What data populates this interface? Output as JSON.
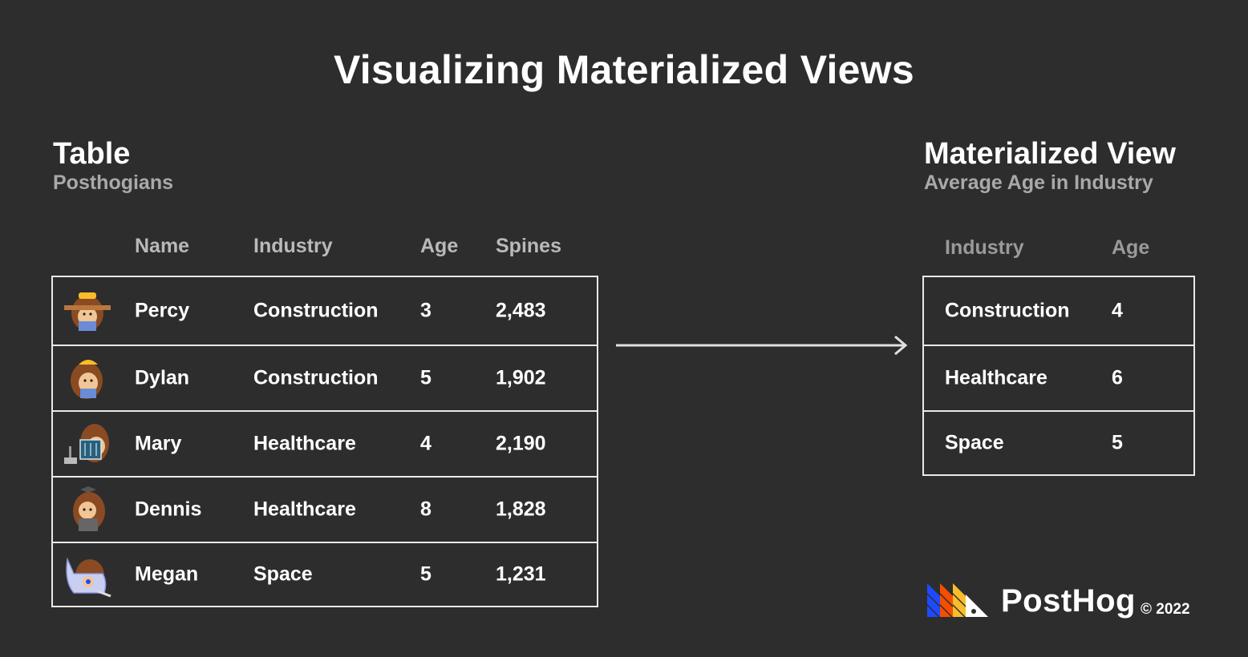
{
  "title": "Visualizing Materialized Views",
  "table": {
    "title": "Table",
    "subtitle": "Posthogians",
    "columns": [
      "Name",
      "Industry",
      "Age",
      "Spines"
    ],
    "rows": [
      {
        "name": "Percy",
        "industry": "Construction",
        "age": "3",
        "spines": "2,483",
        "avatar": "hedgehog-construction-icon"
      },
      {
        "name": "Dylan",
        "industry": "Construction",
        "age": "5",
        "spines": "1,902",
        "avatar": "hedgehog-hardhat-icon"
      },
      {
        "name": "Mary",
        "industry": "Healthcare",
        "age": "4",
        "spines": "2,190",
        "avatar": "hedgehog-xray-icon"
      },
      {
        "name": "Dennis",
        "industry": "Healthcare",
        "age": "8",
        "spines": "1,828",
        "avatar": "hedgehog-doctor-icon"
      },
      {
        "name": "Megan",
        "industry": "Space",
        "age": "5",
        "spines": "1,231",
        "avatar": "hedgehog-astronaut-icon"
      }
    ]
  },
  "view": {
    "title": "Materialized View",
    "subtitle": "Average Age in Industry",
    "columns": [
      "Industry",
      "Age"
    ],
    "rows": [
      {
        "industry": "Construction",
        "age": "4"
      },
      {
        "industry": "Healthcare",
        "age": "6"
      },
      {
        "industry": "Space",
        "age": "5"
      }
    ]
  },
  "brand": {
    "name": "PostHog",
    "copyright": "© 2022",
    "colors": [
      "#1d4aff",
      "#f54e00",
      "#f9bd2b",
      "#ffffff"
    ]
  },
  "colors": {
    "background": "#2d2d2d",
    "text": "#ffffff",
    "muted": "#a9a9a9",
    "border": "#e9e9e9",
    "hog_brown": "#8a4b22",
    "hog_face": "#f1c595"
  }
}
